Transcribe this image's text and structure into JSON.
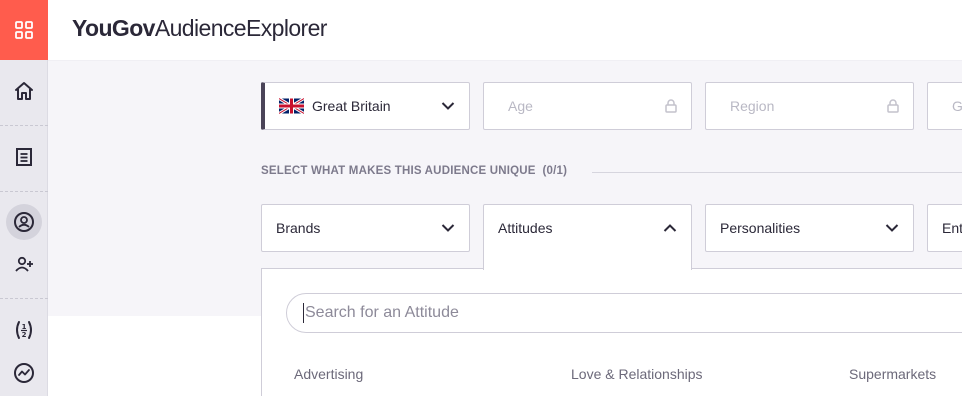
{
  "header": {
    "brand_bold": "YouGov",
    "brand_light": "AudienceExplorer"
  },
  "sidebar": {
    "items": [
      {
        "icon": "home-icon"
      },
      {
        "icon": "document-icon"
      },
      {
        "icon": "audience-icon",
        "active": true
      },
      {
        "icon": "add-user-icon"
      },
      {
        "icon": "compare-icon"
      },
      {
        "icon": "trend-icon"
      }
    ]
  },
  "filters": {
    "country": "Great Britain",
    "age": "Age",
    "region": "Region",
    "fourth": "G"
  },
  "section": {
    "label": "SELECT WHAT MAKES THIS AUDIENCE UNIQUE",
    "count": "(0/1)"
  },
  "categories": {
    "brands": "Brands",
    "attitudes": "Attitudes",
    "personalities": "Personalities",
    "fourth": "Ent"
  },
  "search": {
    "placeholder": "Search for an Attitude",
    "value": ""
  },
  "attitude_groups": [
    "Advertising",
    "Love & Relationships",
    "Supermarkets"
  ],
  "colors": {
    "accent": "#ff5c4d",
    "sidebar": "#e9e8ee",
    "content_bg": "#f6f5f9"
  }
}
